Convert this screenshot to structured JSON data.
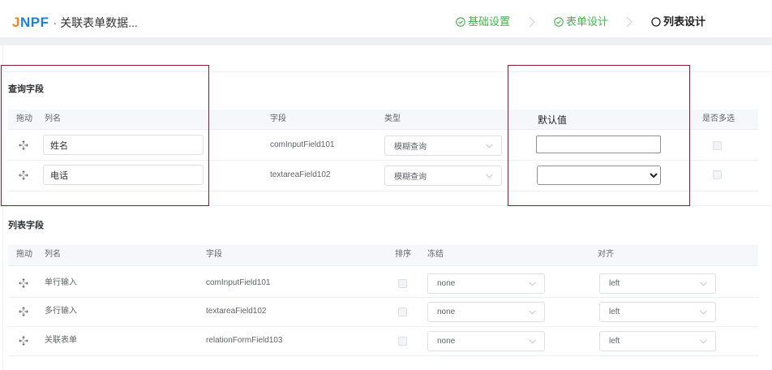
{
  "colors": {
    "logo_j": "#f5841f",
    "logo_rest": "#1f7fe0",
    "step_done": "#43b14b",
    "step_current": "#1f1f1f",
    "annotation": "#8a1a2e"
  },
  "icons": {
    "step_done": "check-circle-icon",
    "step_current": "circle-icon",
    "step_separator": "chevron-right-icon",
    "drag_handle": "move-icon",
    "select_arrow": "chevron-down-icon"
  },
  "header": {
    "logo_first": "J",
    "logo_rest": "NPF",
    "separator": "·",
    "title": "关联表单数据...",
    "steps": [
      {
        "label": "基础设置",
        "completed": true
      },
      {
        "label": "表单设计",
        "completed": true
      },
      {
        "label": "列表设计",
        "completed": false
      }
    ]
  },
  "query_fields": {
    "title": "查询字段",
    "columns": {
      "drag": "拖动",
      "label": "列名",
      "field": "字段",
      "match_type": "类型",
      "default_value": "默认值",
      "multiple": "是否多选"
    },
    "rows": [
      {
        "label": "姓名",
        "field": "comInputField101",
        "match_type": "模糊查询",
        "default_value": "",
        "multiple": false
      },
      {
        "label": "电话",
        "field": "textareaField102",
        "match_type": "模糊查询",
        "default_value": "",
        "multiple": false
      }
    ]
  },
  "list_fields": {
    "title": "列表字段",
    "columns": {
      "drag": "拖动",
      "label": "列名",
      "field": "字段",
      "sortable": "排序",
      "fixed": "冻结",
      "align": "对齐"
    },
    "rows": [
      {
        "label": "单行输入",
        "field": "comInputField101",
        "sortable": false,
        "fixed": "none",
        "align": "left"
      },
      {
        "label": "多行输入",
        "field": "textareaField102",
        "sortable": false,
        "fixed": "none",
        "align": "left"
      },
      {
        "label": "关联表单",
        "field": "relationFormField103",
        "sortable": false,
        "fixed": "none",
        "align": "left"
      }
    ]
  }
}
